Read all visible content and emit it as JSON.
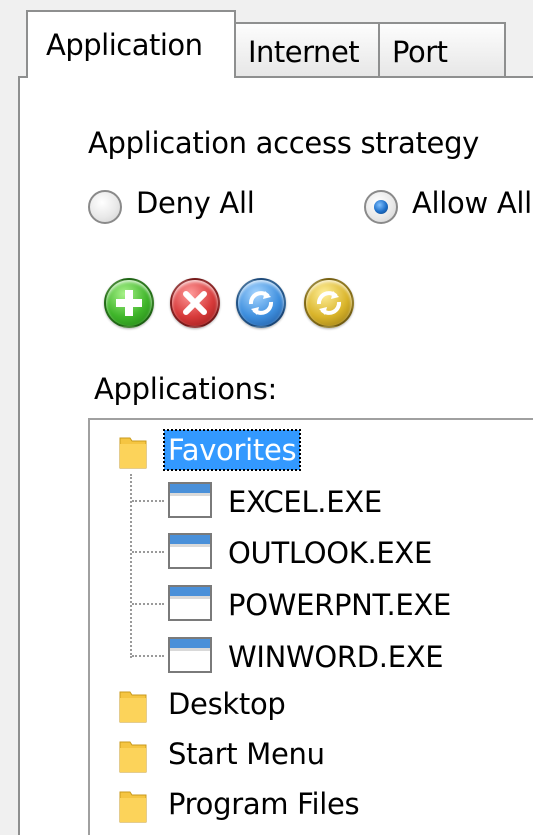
{
  "tabs": [
    {
      "label": "Application",
      "active": true
    },
    {
      "label": "Internet",
      "active": false
    },
    {
      "label": "Port",
      "active": false
    }
  ],
  "strategy": {
    "label": "Application access strategy",
    "options": [
      {
        "label": "Deny All",
        "checked": false
      },
      {
        "label": "Allow All",
        "checked": true
      }
    ]
  },
  "toolbar": {
    "buttons": [
      {
        "icon": "add-icon",
        "color": "#3fb52a"
      },
      {
        "icon": "remove-icon",
        "color": "#d73a3a"
      },
      {
        "icon": "refresh-icon",
        "color": "#3e8fde"
      },
      {
        "icon": "refresh-icon",
        "color": "#d9b42a"
      }
    ]
  },
  "applications": {
    "label": "Applications:",
    "tree": [
      {
        "label": "Favorites",
        "icon": "folder-icon",
        "selected": true,
        "children": [
          {
            "label": "EXCEL.EXE",
            "icon": "application-window-icon"
          },
          {
            "label": "OUTLOOK.EXE",
            "icon": "application-window-icon"
          },
          {
            "label": "POWERPNT.EXE",
            "icon": "application-window-icon"
          },
          {
            "label": "WINWORD.EXE",
            "icon": "application-window-icon"
          }
        ]
      },
      {
        "label": "Desktop",
        "icon": "folder-icon",
        "selected": false
      },
      {
        "label": "Start Menu",
        "icon": "folder-icon",
        "selected": false
      },
      {
        "label": "Program Files",
        "icon": "folder-icon",
        "selected": false
      }
    ]
  },
  "colors": {
    "selection": "#3399ff",
    "folder": "#f5c542",
    "app_icon_titlebar": "#4a90d9"
  }
}
